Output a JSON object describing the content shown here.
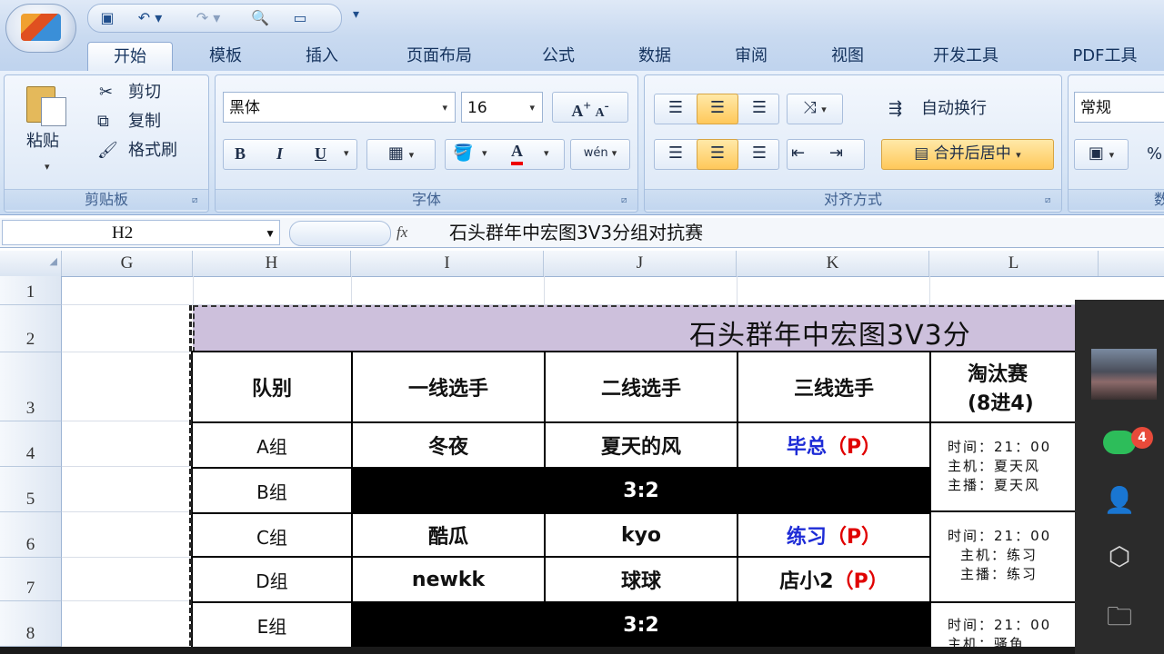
{
  "quick_access": {
    "save_icon": "save-icon",
    "undo_icon": "undo-icon",
    "redo_icon": "redo-icon",
    "preview_icon": "print-preview-icon",
    "new_icon": "new-doc-icon",
    "customize": "▾"
  },
  "tabs": [
    "开始",
    "模板",
    "插入",
    "页面布局",
    "公式",
    "数据",
    "审阅",
    "视图",
    "开发工具",
    "PDF工具"
  ],
  "clipboard": {
    "paste": "粘贴",
    "cut": "剪切",
    "copy": "复制",
    "format_painter": "格式刷",
    "group": "剪贴板"
  },
  "font": {
    "name": "黑体",
    "size": "16",
    "group": "字体",
    "bold": "B",
    "italic": "I",
    "underline": "U",
    "font_color": "A",
    "grow": "A",
    "shrink": "A",
    "phonetic": "wén"
  },
  "alignment": {
    "wrap": "自动换行",
    "merge": "合并后居中",
    "group": "对齐方式"
  },
  "number": {
    "format": "常规",
    "percent": "%",
    "group": "数"
  },
  "formula_bar": {
    "name_box": "H2",
    "fx": "fx",
    "content": "石头群年中宏图3V3分组对抗赛"
  },
  "columns": [
    "G",
    "H",
    "I",
    "J",
    "K",
    "L"
  ],
  "rows": [
    "1",
    "2",
    "3",
    "4",
    "5",
    "6",
    "7",
    "8"
  ],
  "sheet": {
    "title": "石头群年中宏图3V3分",
    "headers": [
      "队别",
      "一线选手",
      "二线选手",
      "三线选手"
    ],
    "knockout_header": [
      "淘汰赛",
      "(8进4)"
    ],
    "groups": [
      "A组",
      "B组",
      "C组",
      "D组",
      "E组"
    ],
    "rowA": {
      "p1": "冬夜",
      "p2": "夏天的风",
      "p3": "毕总",
      "p3_tag": "（P）"
    },
    "score1": "3:2",
    "rowC": {
      "p1": "酷瓜",
      "p2": "kyo",
      "p3": "练习",
      "p3_tag": "（P）"
    },
    "rowD": {
      "p1": "newkk",
      "p2": "球球",
      "p3": "店小2",
      "p3_tag": "（P）"
    },
    "score2": "3:2",
    "note1": [
      "时间：21：00",
      "主机：夏天风",
      "主播：夏天风"
    ],
    "note2": [
      "时间：21：00",
      "主机：练习",
      "主播：练习"
    ],
    "note3": [
      "时间：21：00",
      "主机：骚鱼"
    ]
  },
  "side_panel": {
    "badge": "4",
    "icons": [
      "photo-thumbnail",
      "chat-icon",
      "contacts-icon",
      "box-icon",
      "folder-icon"
    ]
  }
}
